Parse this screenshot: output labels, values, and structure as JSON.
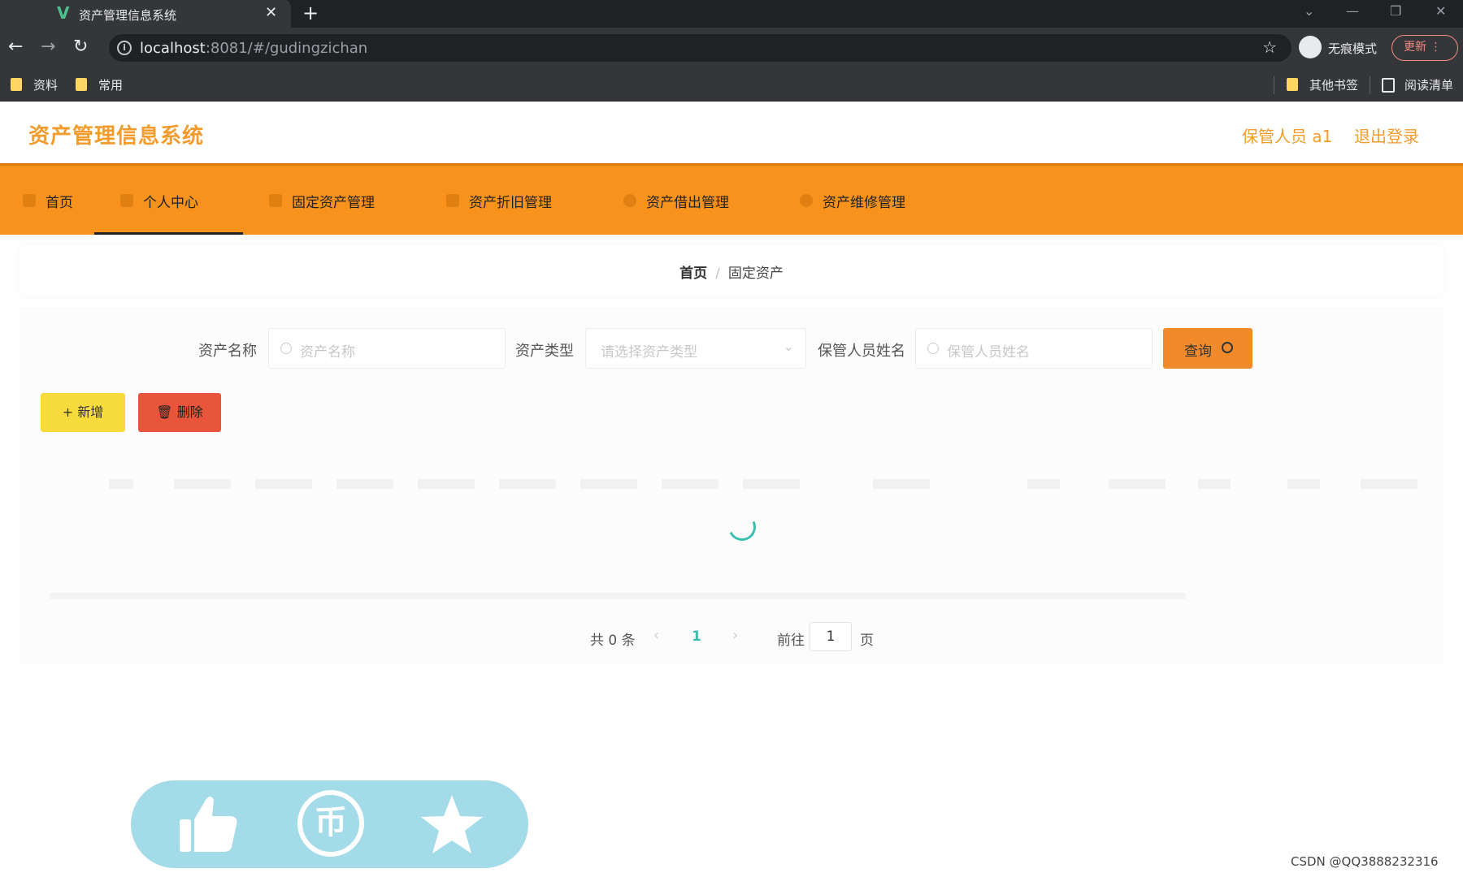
{
  "browser": {
    "tab_title": "资产管理信息系统",
    "url_host": "localhost",
    "url_rest": ":8081/#/gudingzichan",
    "incognito_label": "无痕模式",
    "update_label": "更新",
    "bookmarks": [
      "资料",
      "常用"
    ],
    "bookmarks_right": [
      "其他书签",
      "阅读清单"
    ]
  },
  "header": {
    "title": "资产管理信息系统",
    "user": "保管人员 a1",
    "logout": "退出登录"
  },
  "nav": [
    {
      "label": "首页",
      "active": false
    },
    {
      "label": "个人中心",
      "active": true
    },
    {
      "label": "固定资产管理",
      "active": false
    },
    {
      "label": "资产折旧管理",
      "active": false
    },
    {
      "label": "资产借出管理",
      "active": false
    },
    {
      "label": "资产维修管理",
      "active": false
    }
  ],
  "breadcrumb": {
    "home": "首页",
    "separator": "/",
    "current": "固定资产"
  },
  "search": {
    "name_label": "资产名称",
    "name_placeholder": "资产名称",
    "type_label": "资产类型",
    "type_placeholder": "请选择资产类型",
    "keeper_label": "保管人员姓名",
    "keeper_placeholder": "保管人员姓名",
    "query_label": "查询"
  },
  "actions": {
    "add_label": "+ 新增",
    "delete_label": "删除"
  },
  "pagination": {
    "total_text": "共 0 条",
    "current_page": "1",
    "goto_label": "前往",
    "goto_value": "1",
    "unit": "页"
  },
  "watermark": "CSDN @QQ3888232316",
  "colors": {
    "accent": "#f7931d",
    "title": "#f39c2e",
    "add": "#f8dc3e",
    "delete": "#e9553a",
    "page_active": "#3bbfb0",
    "pill": "#a4dbe8"
  }
}
